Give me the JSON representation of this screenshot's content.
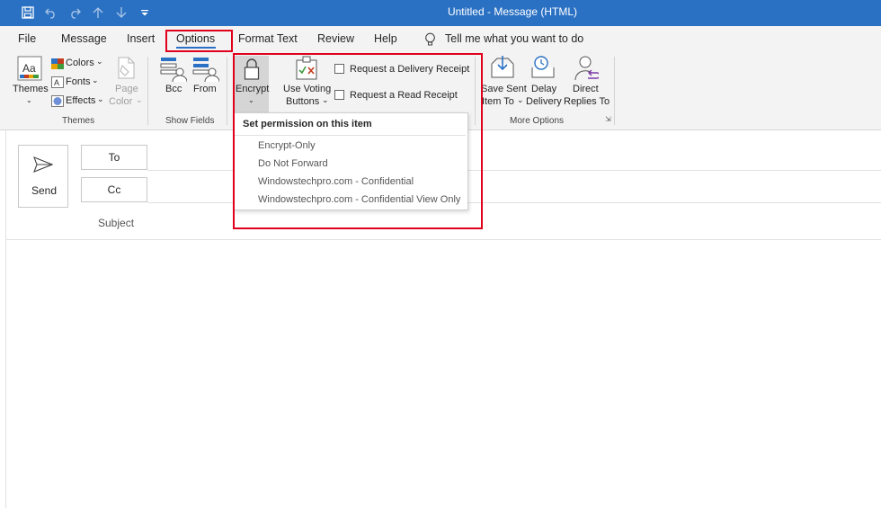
{
  "window": {
    "title": "Untitled  -  Message (HTML)"
  },
  "tabs": [
    {
      "label": "File"
    },
    {
      "label": "Message"
    },
    {
      "label": "Insert"
    },
    {
      "label": "Options"
    },
    {
      "label": "Format Text"
    },
    {
      "label": "Review"
    },
    {
      "label": "Help"
    }
  ],
  "tell_me": "Tell me what you want to do",
  "ribbon": {
    "themes": {
      "themes": "Themes",
      "colors": "Colors",
      "fonts": "Fonts",
      "effects": "Effects",
      "page_color_1": "Page",
      "page_color_2": "Color",
      "group": "Themes"
    },
    "show_fields": {
      "bcc": "Bcc",
      "from": "From",
      "group": "Show Fields"
    },
    "permission": {
      "encrypt": "Encrypt",
      "voting_1": "Use Voting",
      "voting_2": "Buttons",
      "delivery_receipt": "Request a Delivery Receipt",
      "read_receipt": "Request a Read Receipt"
    },
    "more_options": {
      "save_sent_1": "Save Sent",
      "save_sent_2": "Item To",
      "delay_1": "Delay",
      "delay_2": "Delivery",
      "direct_1": "Direct",
      "direct_2": "Replies To",
      "group": "More Options"
    }
  },
  "dropdown": {
    "header": "Set permission on this item",
    "items": [
      "Encrypt-Only",
      "Do Not Forward",
      "Windowstechpro.com - Confidential",
      "Windowstechpro.com - Confidential View Only"
    ]
  },
  "compose": {
    "send": "Send",
    "to": "To",
    "cc": "Cc",
    "subject": "Subject"
  },
  "colors": {
    "titlebar": "#2b71c3",
    "highlight_red": "#e0001b",
    "ribbon_bg": "#f3f3f3"
  }
}
